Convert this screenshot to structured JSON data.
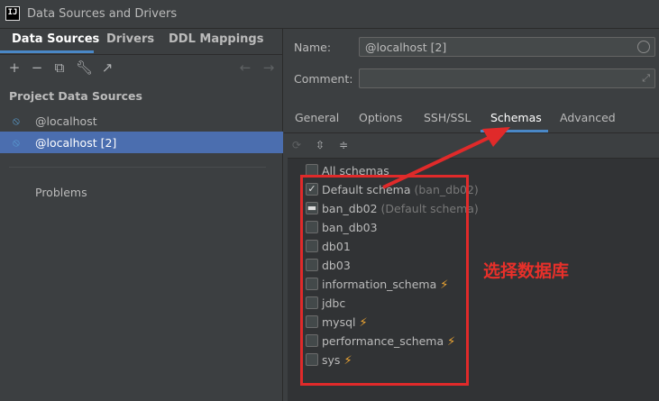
{
  "window": {
    "title": "Data Sources and Drivers"
  },
  "left": {
    "tabs": [
      {
        "label": "Data Sources"
      },
      {
        "label": "Drivers"
      },
      {
        "label": "DDL Mappings"
      }
    ],
    "section_title": "Project Data Sources",
    "data_sources": [
      {
        "label": "@localhost",
        "selected": false
      },
      {
        "label": "@localhost [2]",
        "selected": true
      }
    ],
    "problems_label": "Problems"
  },
  "right": {
    "name_label": "Name:",
    "name_value": "@localhost [2]",
    "comment_label": "Comment:",
    "comment_value": "",
    "tabs": [
      {
        "label": "General"
      },
      {
        "label": "Options"
      },
      {
        "label": "SSH/SSL"
      },
      {
        "label": "Schemas"
      },
      {
        "label": "Advanced"
      }
    ],
    "active_tab": "Schemas",
    "all_schemas_label": "All schemas",
    "schemas": [
      {
        "name": "Default schema",
        "note": "(ban_db02)",
        "state": "checked",
        "bolt": false
      },
      {
        "name": "ban_db02",
        "note": "(Default schema)",
        "state": "indeterminate",
        "bolt": false
      },
      {
        "name": "ban_db03",
        "note": "",
        "state": "unchecked",
        "bolt": false
      },
      {
        "name": "db01",
        "note": "",
        "state": "unchecked",
        "bolt": false
      },
      {
        "name": "db03",
        "note": "",
        "state": "unchecked",
        "bolt": false
      },
      {
        "name": "information_schema",
        "note": "",
        "state": "unchecked",
        "bolt": true
      },
      {
        "name": "jdbc",
        "note": "",
        "state": "unchecked",
        "bolt": false
      },
      {
        "name": "mysql",
        "note": "",
        "state": "unchecked",
        "bolt": true
      },
      {
        "name": "performance_schema",
        "note": "",
        "state": "unchecked",
        "bolt": true
      },
      {
        "name": "sys",
        "note": "",
        "state": "unchecked",
        "bolt": true
      }
    ]
  },
  "annotation": {
    "text": "选择数据库",
    "color": "#e02a2a"
  },
  "colors": {
    "accent": "#4a88c7",
    "selection": "#4b6eaf",
    "bolt": "#f0a732"
  }
}
